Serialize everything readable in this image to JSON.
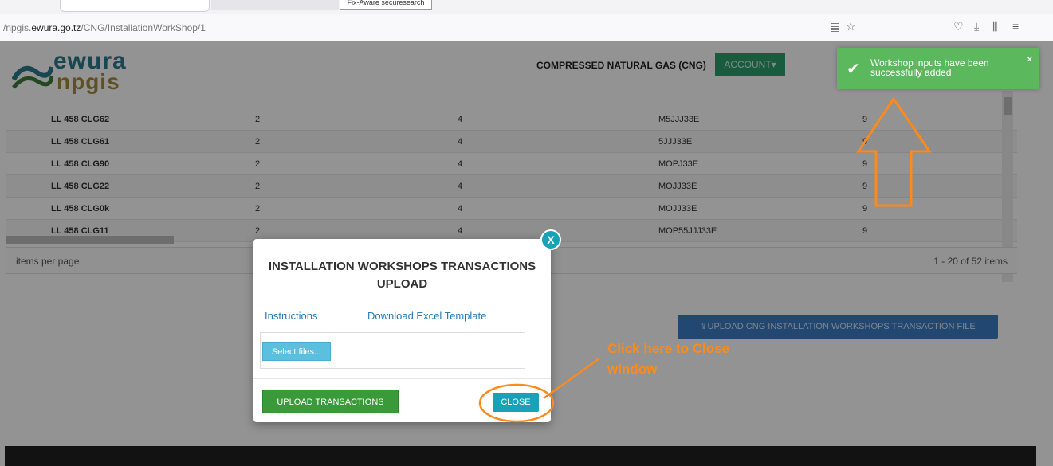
{
  "browser": {
    "url_prefix": "/npgis.",
    "url_domain": "ewura.go.tz",
    "url_path": "/CNG/InstallationWorkShop/1",
    "tooltip": "Fix-Aware securesearch"
  },
  "header": {
    "logo_top": "ewura",
    "logo_bottom": "npgis",
    "section_title": "COMPRESSED NATURAL GAS (CNG)",
    "account_label": "ACCOUNT"
  },
  "table": {
    "rows": [
      {
        "c1": "LL 458 CLG62",
        "c2": "2",
        "c3": "4",
        "c4": "M5JJJ33E",
        "c5": "9"
      },
      {
        "c1": "LL 458 CLG61",
        "c2": "2",
        "c3": "4",
        "c4": "5JJJ33E",
        "c5": "9"
      },
      {
        "c1": "LL 458 CLG90",
        "c2": "2",
        "c3": "4",
        "c4": "MOPJ33E",
        "c5": "9"
      },
      {
        "c1": "LL 458 CLG22",
        "c2": "2",
        "c3": "4",
        "c4": "MOJJ33E",
        "c5": "9"
      },
      {
        "c1": "LL 458 CLG0k",
        "c2": "2",
        "c3": "4",
        "c4": "MOJJ33E",
        "c5": "9"
      },
      {
        "c1": "LL 458 CLG11",
        "c2": "2",
        "c3": "4",
        "c4": "MOP55JJJ33E",
        "c5": "9"
      }
    ]
  },
  "pager": {
    "items_per_page": "items per page",
    "range": "1 - 20 of 52 items"
  },
  "upload_main_label": "UPLOAD CNG INSTALLATION WORKSHOPS TRANSACTION FILE",
  "toast": {
    "message": "Workshop inputs have been successfully added",
    "close": "×"
  },
  "modal": {
    "close_x": "X",
    "title": "INSTALLATION WORKSHOPS TRANSACTIONS UPLOAD",
    "instructions": "Instructions",
    "download_template": "Download Excel Template",
    "select_files": "Select files...",
    "upload_button": "UPLOAD TRANSACTIONS",
    "close_button": "CLOSE"
  },
  "annotation": {
    "line1": "Click here to Close",
    "line2": "window"
  },
  "colors": {
    "annotation": "#ff8a1a",
    "toast": "#5cb85c",
    "close_button": "#17a2b8",
    "upload_button": "#3a9a3a"
  }
}
